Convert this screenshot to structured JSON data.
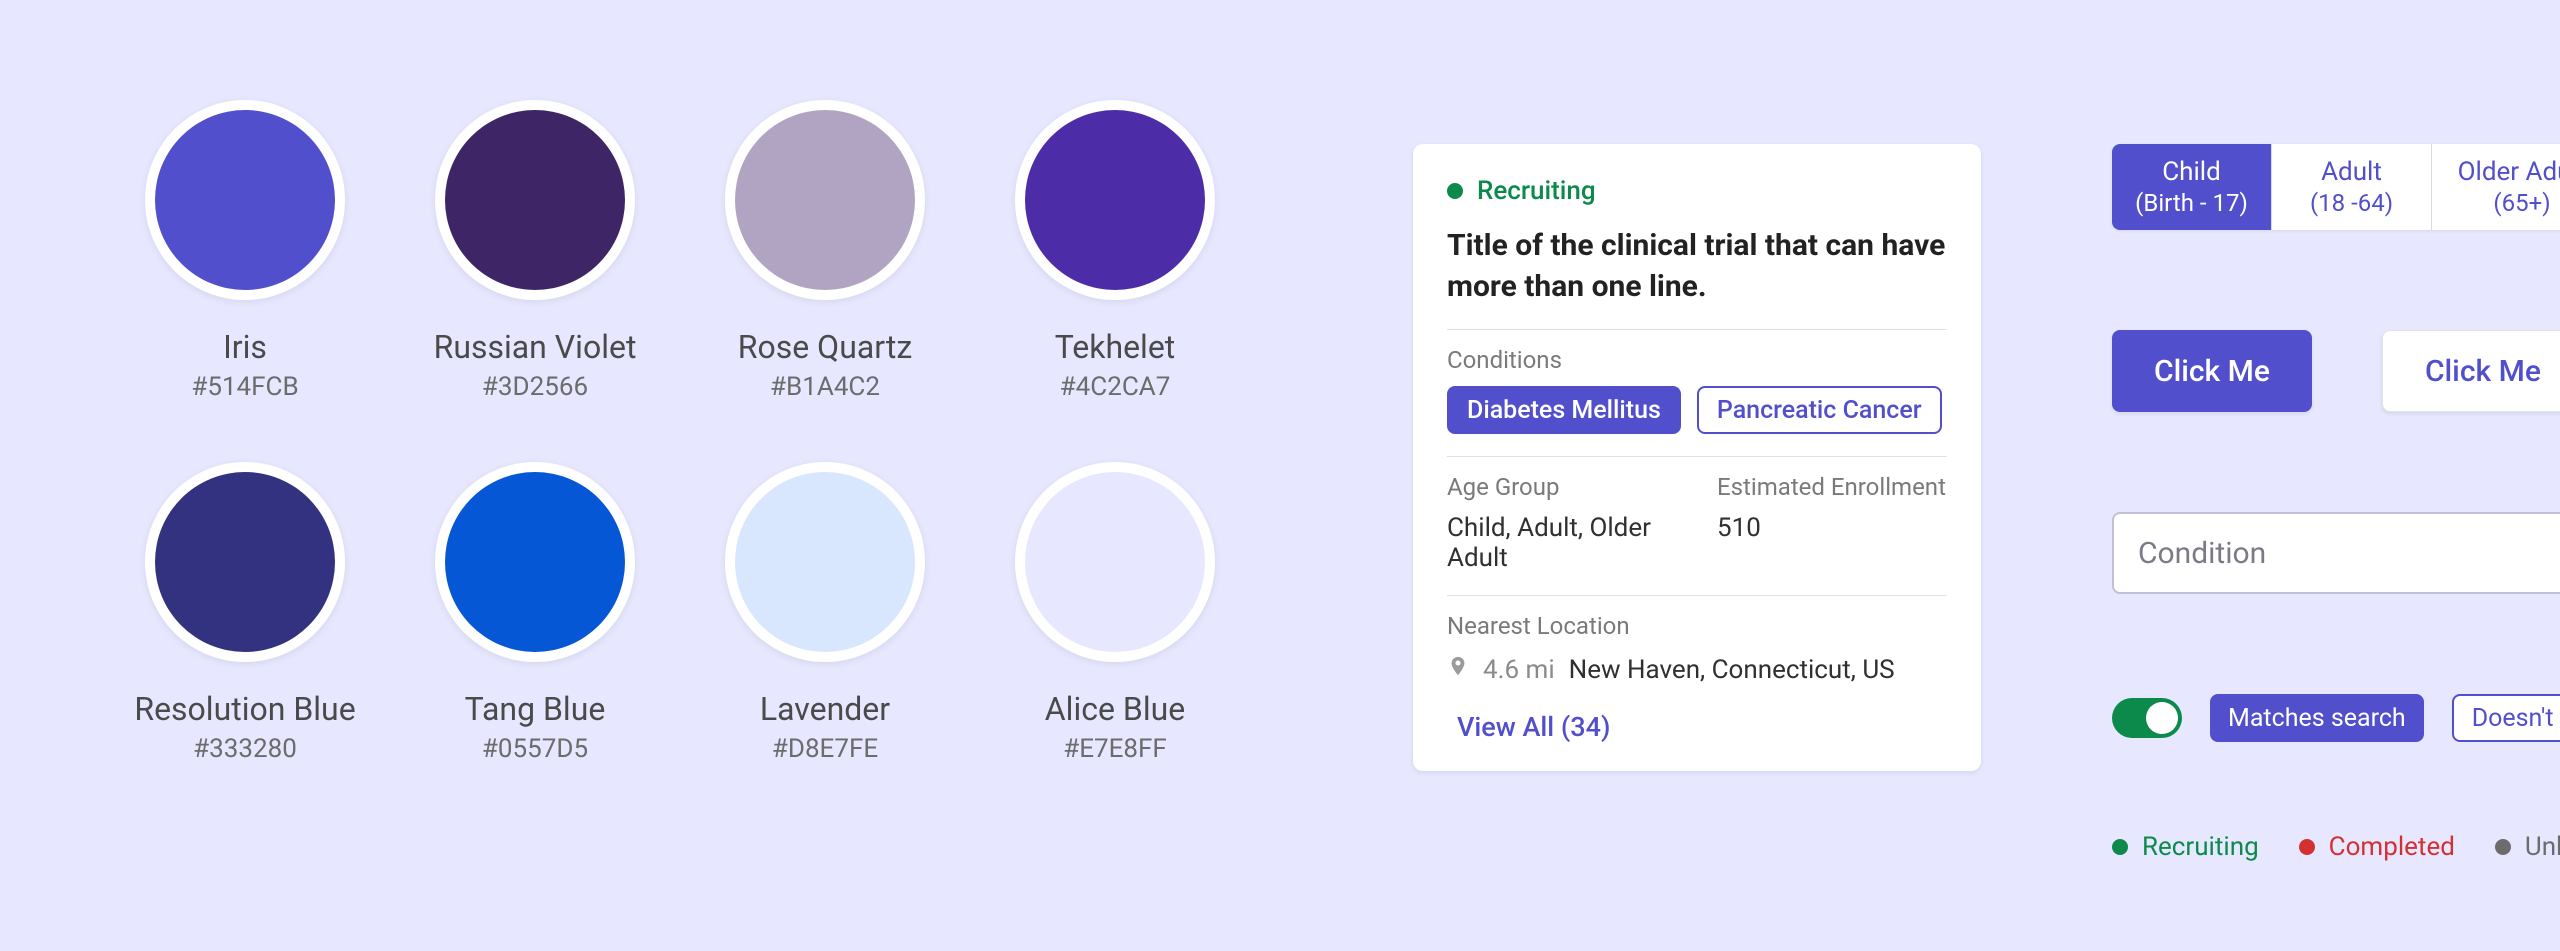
{
  "palette": [
    {
      "name": "Iris",
      "hex": "#514FCB"
    },
    {
      "name": "Russian Violet",
      "hex": "#3D2566"
    },
    {
      "name": "Rose Quartz",
      "hex": "#B1A4C2"
    },
    {
      "name": "Tekhelet",
      "hex": "#4C2CA7"
    },
    {
      "name": "Resolution Blue",
      "hex": "#333280"
    },
    {
      "name": "Tang Blue",
      "hex": "#0557D5"
    },
    {
      "name": "Lavender",
      "hex": "#D8E7FE"
    },
    {
      "name": "Alice Blue",
      "hex": "#E7E8FF"
    }
  ],
  "trial": {
    "status_label": "Recruiting",
    "status_color": "#0C8A4B",
    "title": "Title of the clinical trial that can have more than one line.",
    "conditions_label": "Conditions",
    "conditions": [
      "Diabetes Mellitus",
      "Pancreatic Cancer"
    ],
    "age_group_label": "Age Group",
    "age_group_value": "Child, Adult, Older Adult",
    "enrollment_label": "Estimated Enrollment",
    "enrollment_value": "510",
    "nearest_location_label": "Nearest Location",
    "distance": "4.6 mi",
    "location": "New Haven, Connecticut, US",
    "view_all": "View All (34)"
  },
  "segments": [
    {
      "label": "Child",
      "sub": "(Birth - 17)",
      "active": true
    },
    {
      "label": "Adult",
      "sub": "(18 -64)",
      "active": false
    },
    {
      "label": "Older Adult",
      "sub": "(65+)",
      "active": false
    }
  ],
  "buttons": {
    "primary": "Click Me",
    "secondary": "Click Me"
  },
  "input": {
    "placeholder": "Condition"
  },
  "filter": {
    "match": "Matches search",
    "no_match": "Doesn't match"
  },
  "legend": [
    {
      "label": "Recruiting",
      "cls": "green"
    },
    {
      "label": "Completed",
      "cls": "red"
    },
    {
      "label": "Unknown",
      "cls": "grey"
    }
  ]
}
